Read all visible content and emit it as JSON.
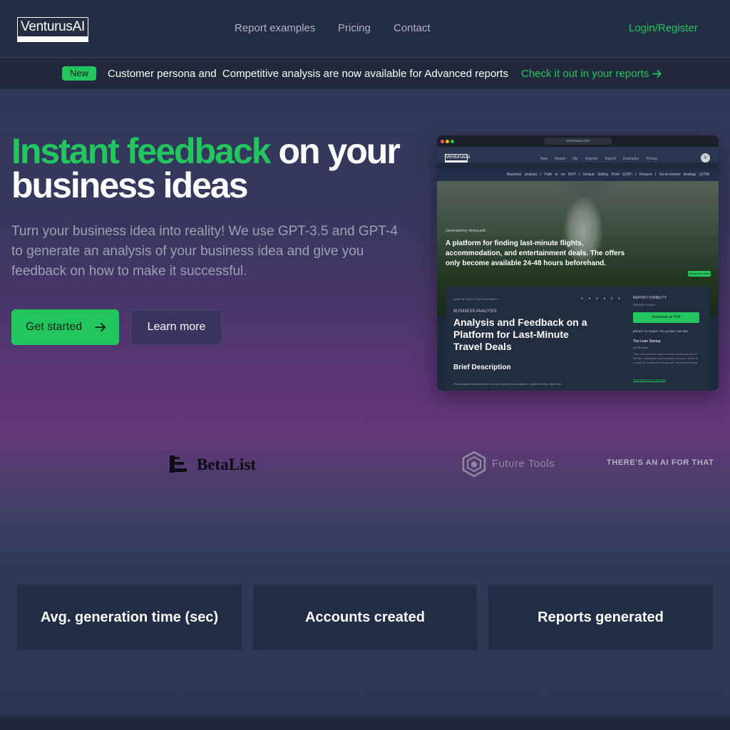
{
  "header": {
    "logo_text": "VenturusAI",
    "nav": [
      "Report examples",
      "Pricing",
      "Contact"
    ],
    "login_label": "Login/Register"
  },
  "announcement": {
    "badge": "New",
    "text": "Customer persona and  Competitive analysis are now available for Advanced reports",
    "link_label": "Check it out in your reports"
  },
  "hero": {
    "title_highlight": "Instant feedback",
    "title_rest": " on your business ideas",
    "subtitle": "Turn your business idea into reality! We use GPT-3.5 and GPT-4 to generate an analysis of your business idea and give you feedback on how to make it successful.",
    "primary_button": "Get started",
    "secondary_button": "Learn more"
  },
  "preview": {
    "url": "venturusai.com",
    "logo": "VenturusAI",
    "nav_links": "New Report My Reports Report Examples Pricing",
    "avatar": "V",
    "tabs": "Business analysis | Path to an MVP | Unique Selling Point (USP) | Finance | Go-to-market strategy (GTM)",
    "generated_by": "Generated by VenturusAI",
    "headline": "A platform for finding last-minute flights, accommodation, and entertainment deals. The offers only become available 24-48 hours beforehand.",
    "advanced_badge": "Advanced report",
    "date": "JUNE 18, 2023 07:18:43 AM GMT+1",
    "category": "BUSINESS ANALYSIS",
    "title": "Analysis and Feedback on a Platform for Last-Minute Travel Deals",
    "section": "Brief Description",
    "body": "The analyzed business idea revolves around the creation of a platform that offers last-",
    "visibility_label": "REPORT VISIBILITY",
    "visibility_toggle": "PRIVATE   PUBLIC",
    "download_label": "Download as PDF",
    "books_label": "BOOKS TO GUIDE YOU ALONG THE WAY",
    "book_title": "The Lean Startup",
    "book_author": "by Eric Ries",
    "book_desc": "This book teaches how to create a business that is efficient, adaptable and customer-focused, which is crucial for a platform dealing with last-minute deals.",
    "book_link": "Find this book on Amazon"
  },
  "logos": {
    "betalist": "BetaList",
    "futuretools": "Future Tools",
    "aiforthat": "THERE'S AN AI FOR THAT"
  },
  "stats": [
    {
      "label": "Avg. generation time (sec)"
    },
    {
      "label": "Accounts created"
    },
    {
      "label": "Reports generated"
    }
  ],
  "colors": {
    "accent": "#22c55e",
    "header_bg": "#232d43",
    "card_bg": "#222c44"
  }
}
